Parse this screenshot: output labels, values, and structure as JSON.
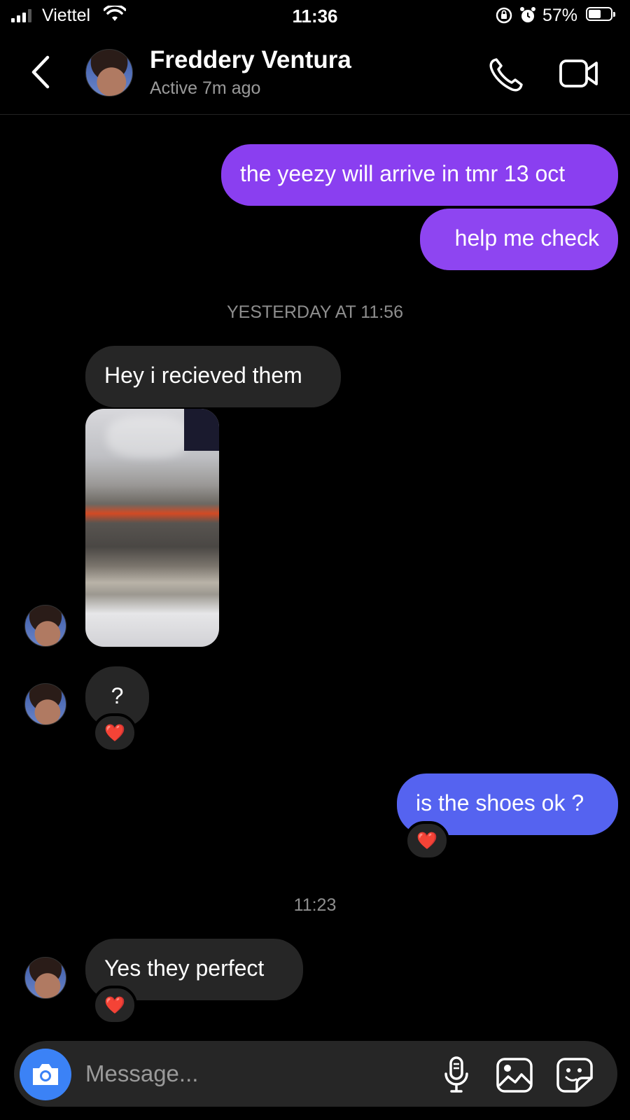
{
  "status_bar": {
    "carrier": "Viettel",
    "time": "11:36",
    "battery": "57%",
    "battery_level": 0.57
  },
  "header": {
    "contact_name": "Freddery Ventura",
    "status": "Active 7m ago"
  },
  "conversation": [
    {
      "type": "outgoing",
      "text": "the yeezy will arrive in tmr 13 oct"
    },
    {
      "type": "outgoing",
      "text": "help me check"
    },
    {
      "type": "timestamp",
      "text": "YESTERDAY AT 11:56"
    },
    {
      "type": "incoming",
      "text": "Hey i recieved them"
    },
    {
      "type": "incoming_photo",
      "alt": "shoe-photo"
    },
    {
      "type": "incoming",
      "text": "?",
      "reaction": "❤️"
    },
    {
      "type": "outgoing",
      "text": "is the shoes ok ?",
      "reaction": "❤️"
    },
    {
      "type": "timestamp",
      "text": "11:23"
    },
    {
      "type": "incoming",
      "text": "Yes they perfect",
      "reaction": "❤️"
    }
  ],
  "composer": {
    "placeholder": "Message..."
  },
  "colors": {
    "outgoing_purple": "#8a3ff0",
    "outgoing_blue": "#5563f0",
    "incoming": "#262626",
    "camera_button": "#3b82f6"
  }
}
